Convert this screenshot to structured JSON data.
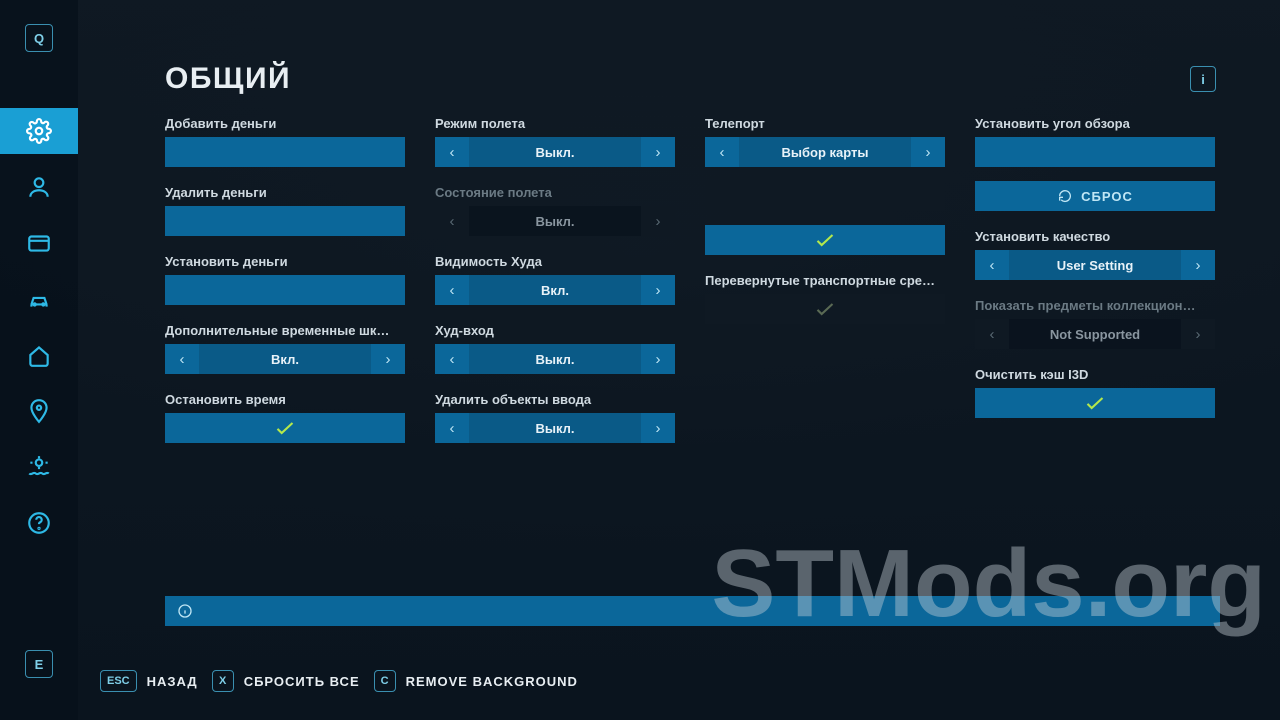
{
  "sidebar": {
    "top_key": "Q",
    "bottom_key": "E"
  },
  "page": {
    "title": "ОБЩИЙ",
    "info_key": "i"
  },
  "col1": {
    "add_money_label": "Добавить деньги",
    "remove_money_label": "Удалить деньги",
    "set_money_label": "Установить деньги",
    "extra_time_label": "Дополнительные временные шк…",
    "extra_time_value": "Вкл.",
    "stop_time_label": "Остановить время"
  },
  "col2": {
    "flight_mode_label": "Режим полета",
    "flight_mode_value": "Выкл.",
    "flight_state_label": "Состояние полета",
    "flight_state_value": "Выкл.",
    "hud_visibility_label": "Видимость Худа",
    "hud_visibility_value": "Вкл.",
    "hud_input_label": "Худ-вход",
    "hud_input_value": "Выкл.",
    "delete_inputs_label": "Удалить объекты ввода",
    "delete_inputs_value": "Выкл."
  },
  "col3": {
    "teleport_label": "Телепорт",
    "teleport_value": "Выбор карты",
    "tip_vehicles_label": "Перевернутые транспортные сре…"
  },
  "col4": {
    "set_fov_label": "Установить угол обзора",
    "reset_label": "СБРОС",
    "set_quality_label": "Установить качество",
    "set_quality_value": "User Setting",
    "show_collect_label": "Показать предметы коллекцион…",
    "show_collect_value": "Not Supported",
    "clear_cache_label": "Очистить кэш I3D"
  },
  "footer": {
    "back_key": "ESC",
    "back_label": "НАЗАД",
    "reset_key": "X",
    "reset_label": "СБРОСИТЬ ВСЕ",
    "bg_key": "C",
    "bg_label": "REMOVE BACKGROUND"
  },
  "watermark": "STMods.org"
}
